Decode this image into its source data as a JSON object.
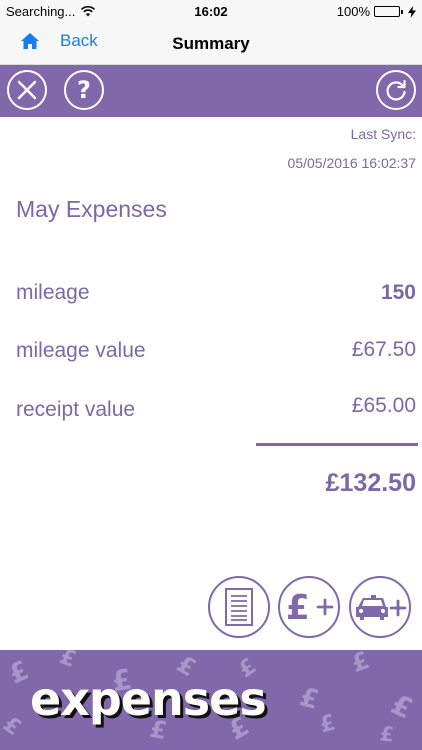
{
  "status_bar": {
    "carrier": "Searching...",
    "time": "16:02",
    "battery": "100%"
  },
  "nav": {
    "back_label": "Back",
    "title": "Summary"
  },
  "sync": {
    "label": "Last Sync:",
    "datetime": "05/05/2016 16:02:37"
  },
  "summary": {
    "title": "May Expenses",
    "rows": [
      {
        "label": "mileage",
        "value": "150"
      },
      {
        "label": "mileage value",
        "value": "£67.50"
      },
      {
        "label": "receipt value",
        "value": "£65.00"
      }
    ],
    "total": "£132.50"
  },
  "footer": {
    "brand": "expenses"
  },
  "colors": {
    "accent": "#8068aa",
    "text": "#7b68a6",
    "link": "#1a7cf0"
  },
  "icons": {
    "close": "close-icon",
    "help": "help-icon",
    "refresh": "refresh-icon",
    "list": "receipt-list-icon",
    "add_expense": "add-pound-icon",
    "add_mileage": "add-car-icon",
    "home": "home-icon"
  }
}
